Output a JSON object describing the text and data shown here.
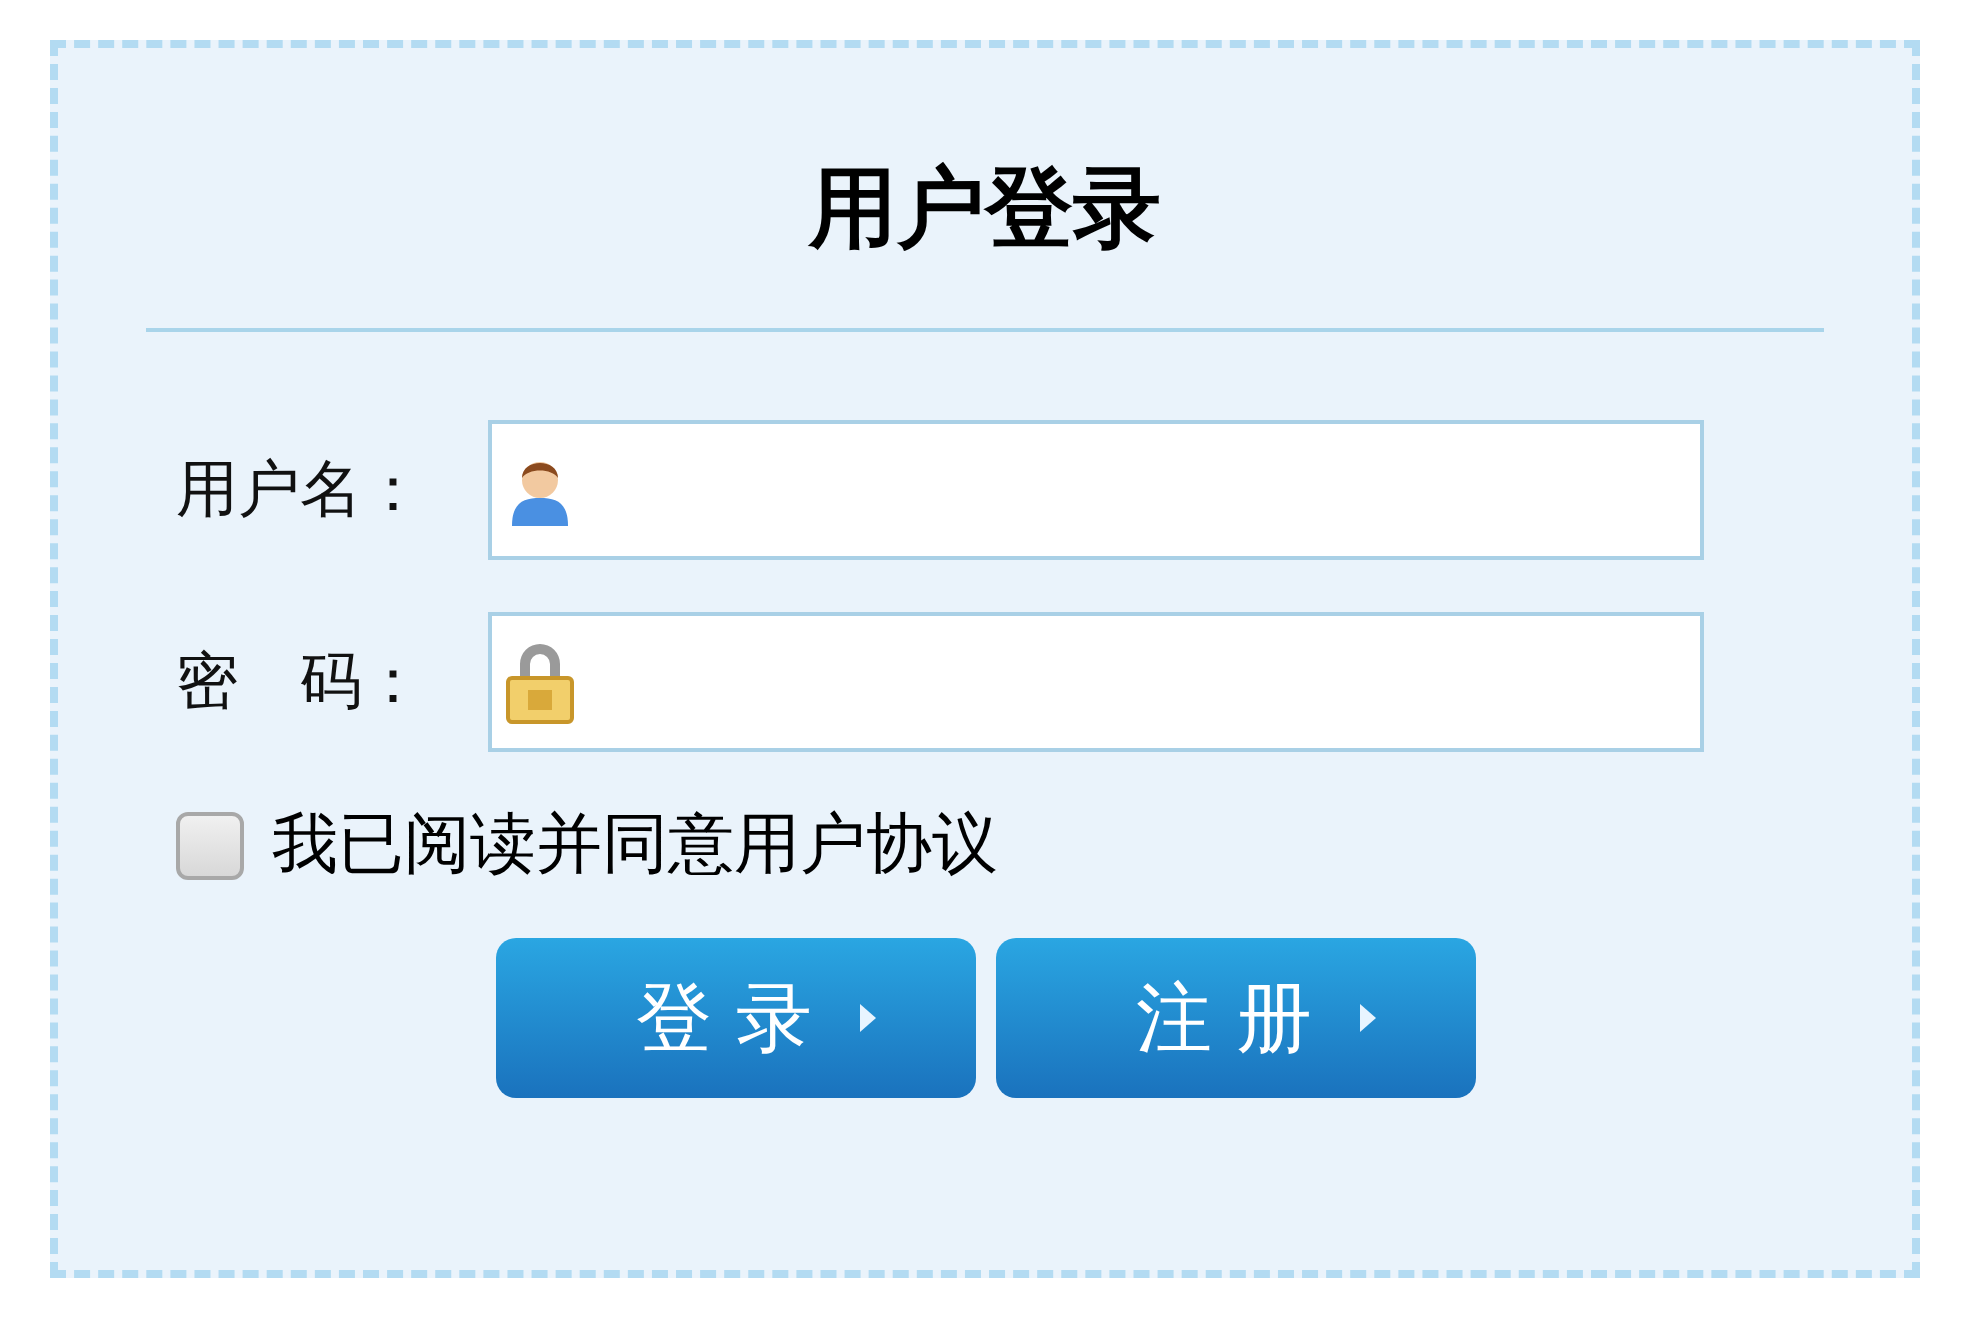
{
  "title": "用户登录",
  "fields": [
    {
      "label": "用户名：",
      "kind": "user"
    },
    {
      "label": "密　码：",
      "kind": "password"
    }
  ],
  "agreement": {
    "label": "我已阅读并同意用户协议",
    "checked": false
  },
  "buttons": [
    "登 录",
    "注 册"
  ]
}
